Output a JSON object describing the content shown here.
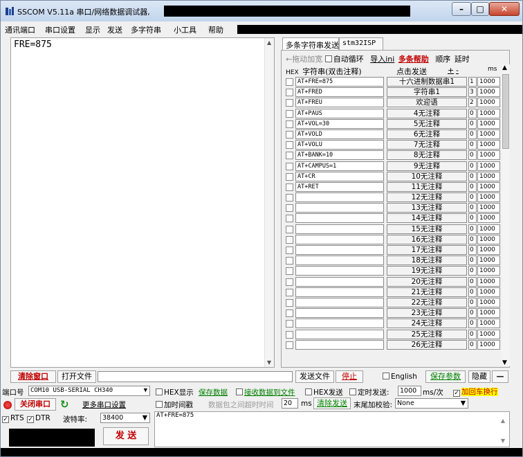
{
  "window": {
    "title": "SSCOM V5.11a 串口/网络数据调试器,"
  },
  "menu": [
    "通讯端口",
    "串口设置",
    "显示",
    "发送",
    "多字符串",
    "小工具",
    "帮助"
  ],
  "receive": {
    "text": "FRE=875"
  },
  "panel": {
    "tabs": [
      "多条字符串发送",
      "stm32ISP"
    ],
    "drag_label": "←拖动加宽",
    "auto_loop_label": "自动循环",
    "import_label": "导入ini",
    "help_label": "多条帮助",
    "order_label": "顺序",
    "delay_label": "延时",
    "hex_label": "HEX",
    "string_header": "字符串(双击注释)",
    "click_send_header": "点击发送",
    "plus": "+",
    "minus": "-",
    "ms_label": "ms",
    "rows": [
      {
        "cmd": "AT+FRE=875",
        "btn": "十六进制数据串1",
        "ord": "1",
        "delay": "1000"
      },
      {
        "cmd": "AT+FRED",
        "btn": "字符串1",
        "ord": "3",
        "delay": "1000"
      },
      {
        "cmd": "AT+FREU",
        "btn": "欢迎语",
        "ord": "2",
        "delay": "1000"
      },
      {
        "cmd": "AT+PAUS",
        "btn": "4无注释",
        "ord": "0",
        "delay": "1000"
      },
      {
        "cmd": "AT+VOL=30",
        "btn": "5无注释",
        "ord": "0",
        "delay": "1000"
      },
      {
        "cmd": "AT+VOLD",
        "btn": "6无注释",
        "ord": "0",
        "delay": "1000"
      },
      {
        "cmd": "AT+VOLU",
        "btn": "7无注释",
        "ord": "0",
        "delay": "1000"
      },
      {
        "cmd": "AT+BANK=10",
        "btn": "8无注释",
        "ord": "0",
        "delay": "1000"
      },
      {
        "cmd": "AT+CAMPUS=1",
        "btn": "9无注释",
        "ord": "0",
        "delay": "1000"
      },
      {
        "cmd": "AT+CR",
        "btn": "10无注释",
        "ord": "0",
        "delay": "1000"
      },
      {
        "cmd": "AT+RET",
        "btn": "11无注释",
        "ord": "0",
        "delay": "1000"
      },
      {
        "cmd": "",
        "btn": "12无注释",
        "ord": "0",
        "delay": "1000"
      },
      {
        "cmd": "",
        "btn": "13无注释",
        "ord": "0",
        "delay": "1000"
      },
      {
        "cmd": "",
        "btn": "14无注释",
        "ord": "0",
        "delay": "1000"
      },
      {
        "cmd": "",
        "btn": "15无注释",
        "ord": "0",
        "delay": "1000"
      },
      {
        "cmd": "",
        "btn": "16无注释",
        "ord": "0",
        "delay": "1000"
      },
      {
        "cmd": "",
        "btn": "17无注释",
        "ord": "0",
        "delay": "1000"
      },
      {
        "cmd": "",
        "btn": "18无注释",
        "ord": "0",
        "delay": "1000"
      },
      {
        "cmd": "",
        "btn": "19无注释",
        "ord": "0",
        "delay": "1000"
      },
      {
        "cmd": "",
        "btn": "20无注释",
        "ord": "0",
        "delay": "1000"
      },
      {
        "cmd": "",
        "btn": "21无注释",
        "ord": "0",
        "delay": "1000"
      },
      {
        "cmd": "",
        "btn": "22无注释",
        "ord": "0",
        "delay": "1000"
      },
      {
        "cmd": "",
        "btn": "23无注释",
        "ord": "0",
        "delay": "1000"
      },
      {
        "cmd": "",
        "btn": "24无注释",
        "ord": "0",
        "delay": "1000"
      },
      {
        "cmd": "",
        "btn": "25无注释",
        "ord": "0",
        "delay": "1000"
      },
      {
        "cmd": "",
        "btn": "26无注释",
        "ord": "0",
        "delay": "1000"
      }
    ]
  },
  "bar1": {
    "clear_window": "清除窗口",
    "open_file": "打开文件",
    "send_file": "发送文件",
    "stop": "停止",
    "english": "English",
    "save_params": "保存参数",
    "hide": "隐藏",
    "dash": "—"
  },
  "controls": {
    "port_label": "端口号",
    "port_value": "COM10 USB-SERIAL CH340",
    "hex_display": "HEX显示",
    "save_data": "保存数据",
    "recv_to_file": "接收数据到文件",
    "hex_send": "HEX发送",
    "timed_send": "定时发送:",
    "timed_value": "1000",
    "ms_per": "ms/次",
    "add_crlf": "加回车换行",
    "close_port": "关闭串口",
    "more_settings": "更多串口设置",
    "add_timestamp": "加时间戳",
    "timeout_hint": "数据包之间超时时间",
    "timeout_value": "20",
    "ms": "ms",
    "clear_send": "清除发送",
    "checksum_label": "末尾加校验:",
    "checksum_value": "None",
    "rts": "RTS",
    "dtr": "DTR",
    "baud_label": "波特率:",
    "baud_value": "38400",
    "send": "发 送",
    "send_text": "AT+FRE=875"
  },
  "colors": {
    "accent_red": "#c00000",
    "link_green": "#008000",
    "highlight_yellow": "#ffff00"
  }
}
